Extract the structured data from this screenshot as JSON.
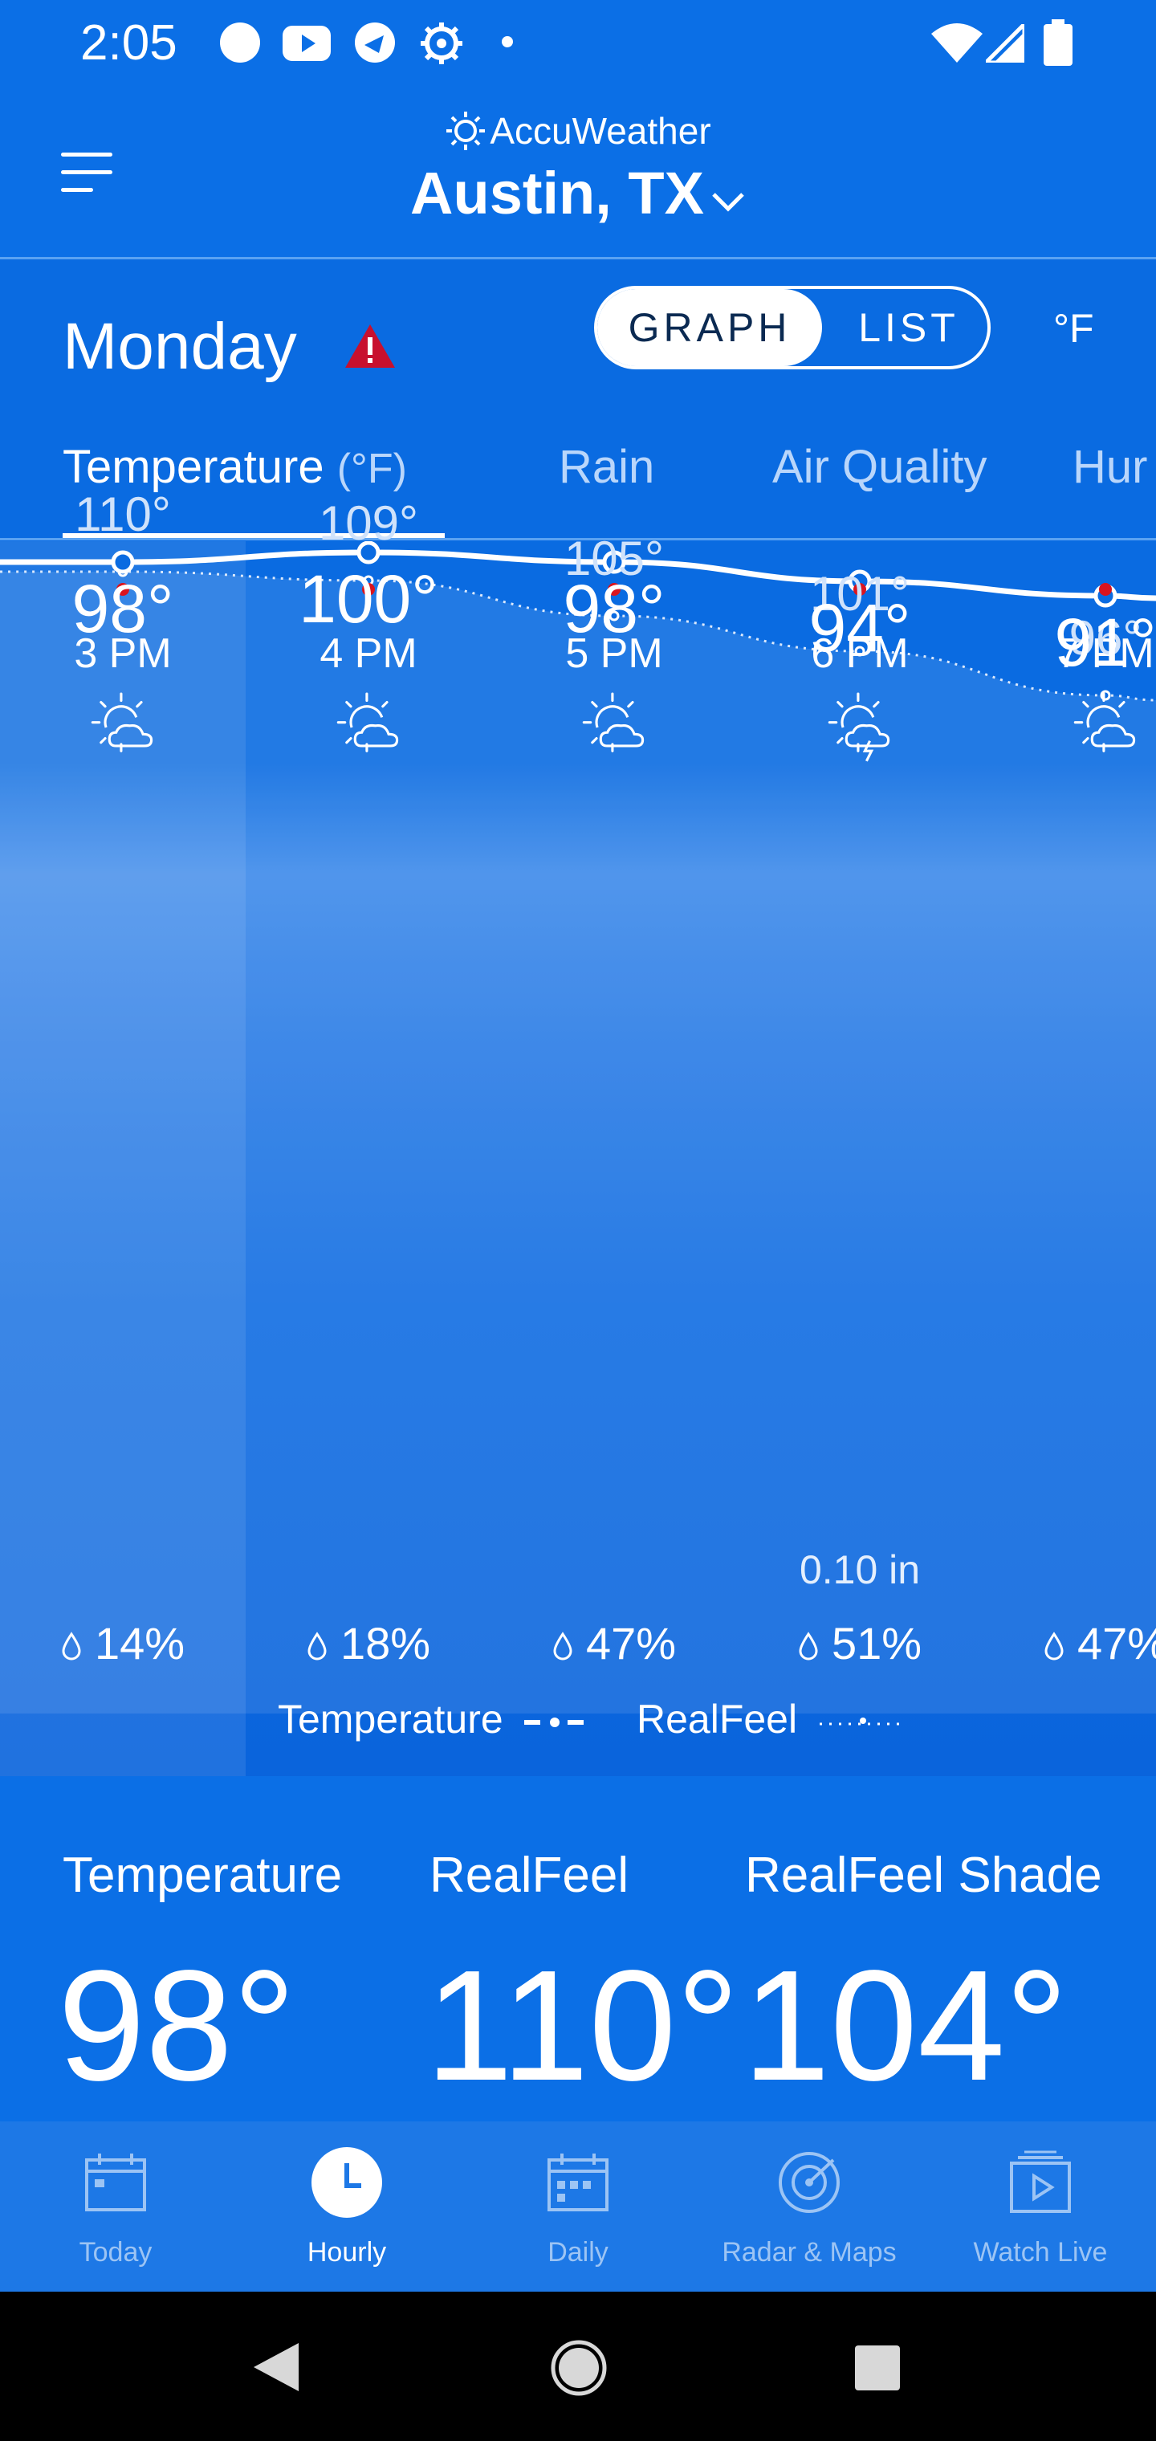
{
  "status_bar": {
    "time": "2:05",
    "left_icons": [
      "circle-notification-icon",
      "youtube-icon",
      "app-notification-icon",
      "gear-notification-icon",
      "dot-icon"
    ],
    "right_icons": [
      "wifi-icon",
      "signal-icon",
      "battery-icon"
    ]
  },
  "header": {
    "brand": "AccuWeather",
    "location": "Austin, TX"
  },
  "day_row": {
    "day": "Monday",
    "toggle_graph": "GRAPH",
    "toggle_list": "LIST",
    "unit": "°F"
  },
  "tabs": [
    {
      "label": "Temperature",
      "suffix": "(°F)"
    },
    {
      "label": "Rain"
    },
    {
      "label": "Air Quality"
    },
    {
      "label": "Hur"
    }
  ],
  "hours": [
    {
      "time": "3 PM",
      "icon": "mostly-sunny-icon",
      "realfeel": "110°",
      "temp": "98°",
      "precip_amount": "",
      "precip_chance": "14%"
    },
    {
      "time": "4 PM",
      "icon": "partly-sunny-icon",
      "realfeel": "109°",
      "temp": "100°",
      "precip_amount": "",
      "precip_chance": "18%"
    },
    {
      "time": "5 PM",
      "icon": "partly-sunny-icon",
      "realfeel": "105°",
      "temp": "98°",
      "precip_amount": "",
      "precip_chance": "47%"
    },
    {
      "time": "6 PM",
      "icon": "thunderstorm-sun-icon",
      "realfeel": "101°",
      "temp": "94°",
      "precip_amount": "0.10 in",
      "precip_chance": "51%"
    },
    {
      "time": "7 PM",
      "icon": "partly-sunny-icon",
      "realfeel": "96°",
      "temp": "91°",
      "precip_amount": "",
      "precip_chance": "47%"
    }
  ],
  "chart_data": {
    "type": "line",
    "x": [
      "3 PM",
      "4 PM",
      "5 PM",
      "6 PM",
      "7 PM"
    ],
    "series": [
      {
        "name": "Temperature",
        "values": [
          98,
          100,
          98,
          94,
          91
        ]
      },
      {
        "name": "RealFeel",
        "values": [
          110,
          109,
          105,
          101,
          96
        ]
      }
    ],
    "precip_chance": [
      14,
      18,
      47,
      51,
      47
    ]
  },
  "legend": {
    "temperature": "Temperature",
    "realfeel": "RealFeel"
  },
  "current": {
    "temperature_label": "Temperature",
    "temperature_value": "98°",
    "realfeel_label": "RealFeel",
    "realfeel_value": "110°",
    "shade_label": "RealFeel Shade",
    "shade_value": "104°"
  },
  "nav": [
    {
      "label": "Today",
      "icon": "calendar-today-icon"
    },
    {
      "label": "Hourly",
      "icon": "clock-icon",
      "active": true
    },
    {
      "label": "Daily",
      "icon": "calendar-daily-icon"
    },
    {
      "label": "Radar & Maps",
      "icon": "radar-icon"
    },
    {
      "label": "Watch Live",
      "icon": "play-icon"
    }
  ],
  "colors": {
    "header_bg": "#0b6fe6",
    "alert": "#c8102e",
    "hour_dot": "#d9141e"
  }
}
